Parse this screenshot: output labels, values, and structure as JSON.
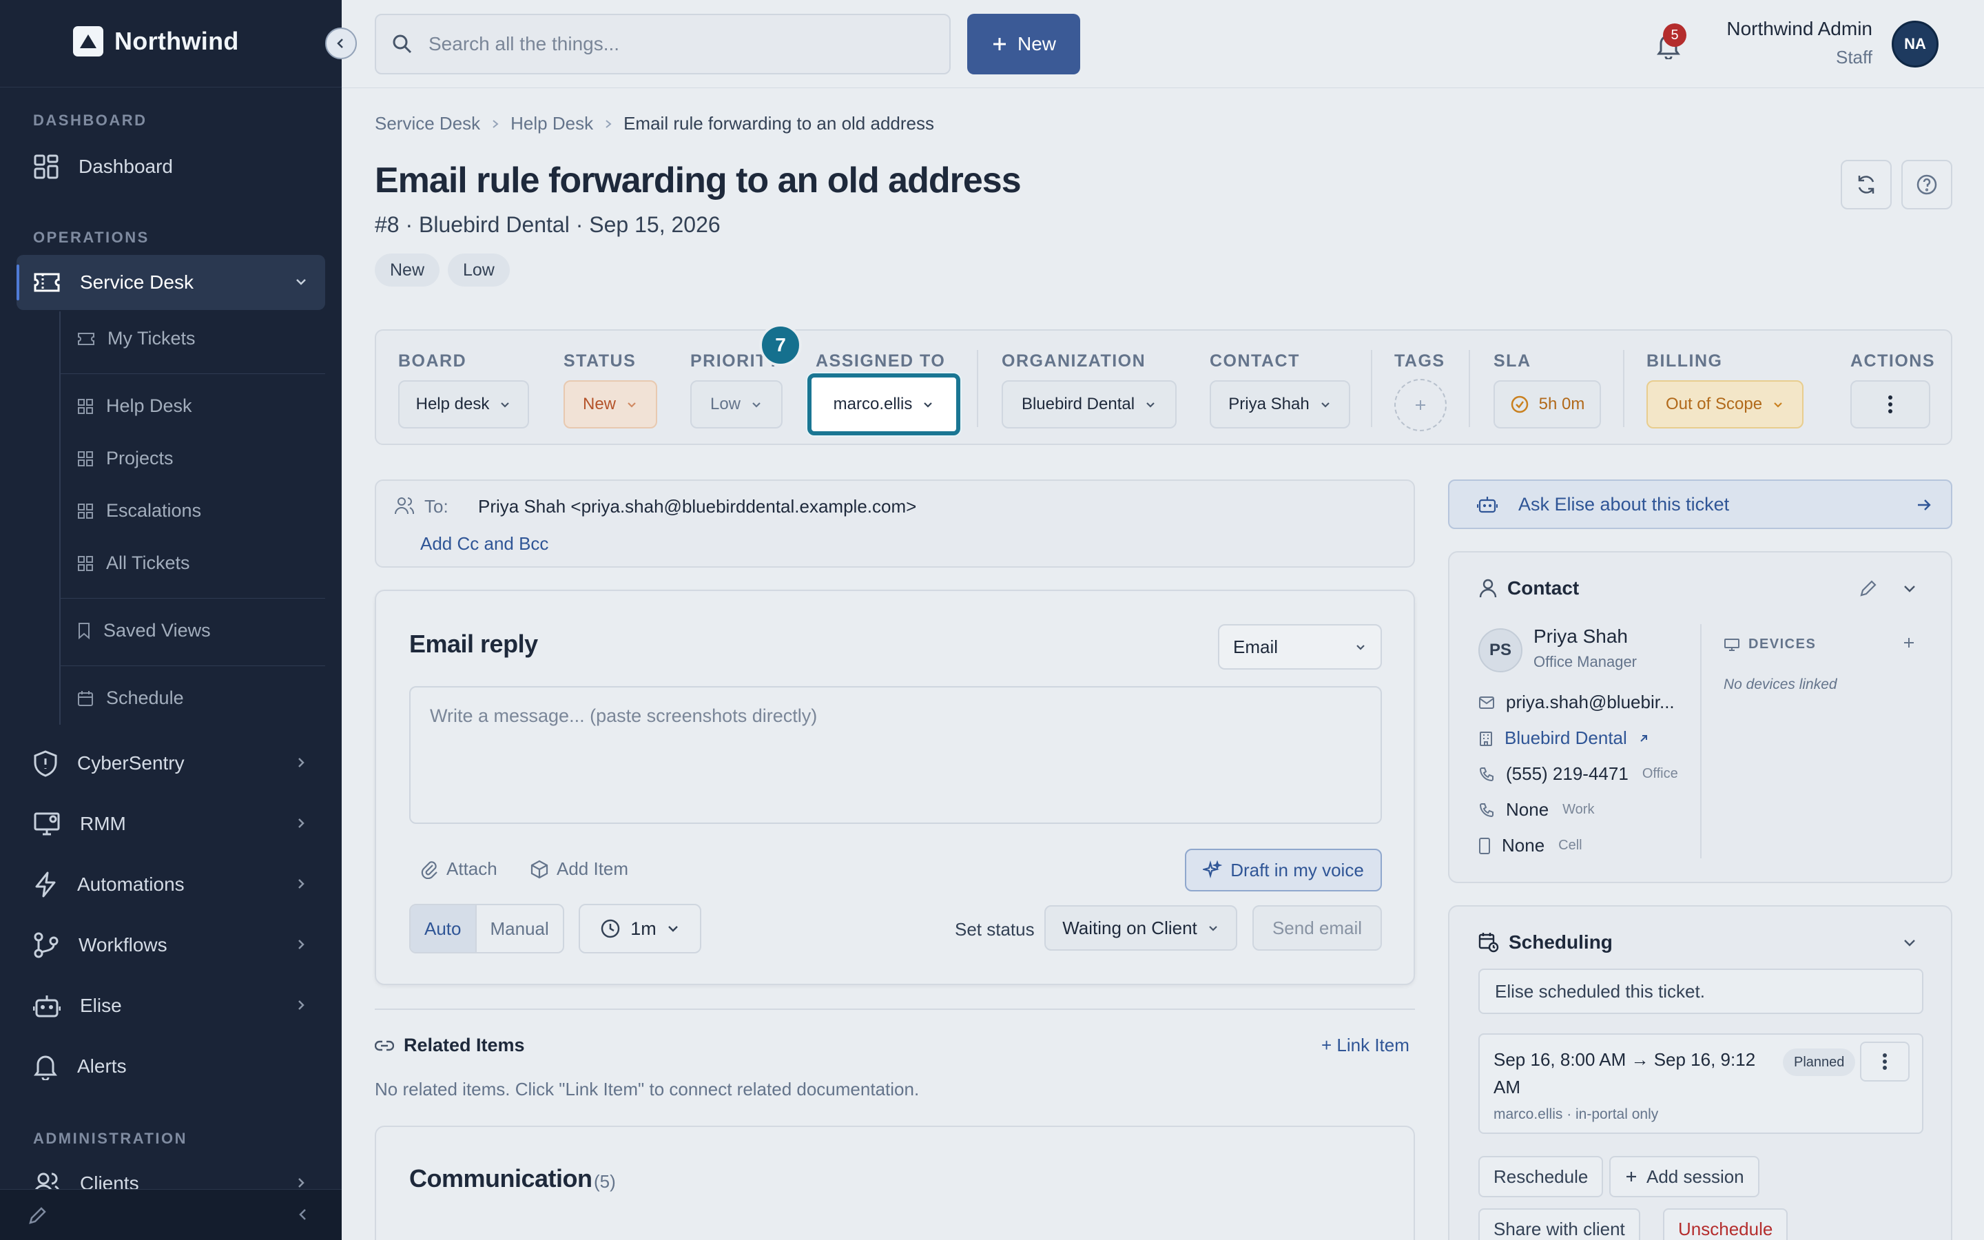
{
  "sidebar": {
    "brand": "Northwind",
    "sections": {
      "dashboard": "DASHBOARD",
      "operations": "OPERATIONS",
      "administration": "ADMINISTRATION"
    },
    "items": {
      "dashboard": "Dashboard",
      "service_desk": "Service Desk",
      "cybersentry": "CyberSentry",
      "rmm": "RMM",
      "automations": "Automations",
      "workflows": "Workflows",
      "elise": "Elise",
      "alerts": "Alerts",
      "clients": "Clients"
    },
    "sub_items": {
      "my_tickets": "My Tickets",
      "help_desk": "Help Desk",
      "projects": "Projects",
      "escalations": "Escalations",
      "all_tickets": "All Tickets",
      "saved_views": "Saved Views",
      "schedule": "Schedule"
    }
  },
  "topbar": {
    "search_placeholder": "Search all the things...",
    "new_label": "New",
    "notification_count": "5",
    "user_name": "Northwind Admin",
    "user_role": "Staff",
    "user_initials": "NA"
  },
  "breadcrumb": [
    "Service Desk",
    "Help Desk",
    "Email rule forwarding to an old address"
  ],
  "ticket": {
    "title": "Email rule forwarding to an old address",
    "subtitle": "#8 · Bluebird Dental · Sep 15, 2026",
    "badges": [
      "New",
      "Low"
    ]
  },
  "fields": {
    "board": {
      "label": "BOARD",
      "value": "Help desk"
    },
    "status": {
      "label": "STATUS",
      "value": "New"
    },
    "priority": {
      "label": "PRIORITY",
      "value": "Low"
    },
    "assigned_to": {
      "label": "ASSIGNED TO",
      "value": "marco.ellis"
    },
    "organization": {
      "label": "ORGANIZATION",
      "value": "Bluebird Dental"
    },
    "contact": {
      "label": "CONTACT",
      "value": "Priya Shah"
    },
    "tags": {
      "label": "TAGS"
    },
    "sla": {
      "label": "SLA",
      "value": "5h 0m"
    },
    "billing": {
      "label": "BILLING",
      "value": "Out of Scope"
    },
    "actions": {
      "label": "ACTIONS"
    }
  },
  "step_marker": "7",
  "recipients": {
    "to_label": "To:",
    "to_value": "Priya Shah <priya.shah@bluebirddental.example.com>",
    "add_cc": "Add Cc and Bcc"
  },
  "reply": {
    "title": "Email reply",
    "channel": "Email",
    "placeholder": "Write a message... (paste screenshots directly)",
    "attach": "Attach",
    "add_item": "Add Item",
    "draft": "Draft in my voice",
    "mode_auto": "Auto",
    "mode_manual": "Manual",
    "timer": "1m",
    "set_status_label": "Set status",
    "status_value": "Waiting on Client",
    "send": "Send email"
  },
  "related": {
    "title": "Related Items",
    "link_item": "+ Link Item",
    "empty": "No related items. Click \"Link Item\" to connect related documentation."
  },
  "communication": {
    "title": "Communication",
    "count": "(5)"
  },
  "right": {
    "ask_elise": "Ask Elise about this ticket",
    "contact": {
      "title": "Contact",
      "initials": "PS",
      "name": "Priya Shah",
      "role": "Office Manager",
      "email": "priya.shah@bluebir...",
      "org": "Bluebird Dental",
      "phone_office": "(555) 219-4471",
      "phone_office_tag": "Office",
      "phone_work": "None",
      "phone_work_tag": "Work",
      "phone_cell": "None",
      "phone_cell_tag": "Cell",
      "devices_label": "DEVICES",
      "devices_empty": "No devices linked"
    },
    "scheduling": {
      "title": "Scheduling",
      "note": "Elise scheduled this ticket.",
      "session_time": "Sep 16, 8:00 AM → Sep 16, 9:12 AM",
      "session_meta": "marco.ellis · in-portal only",
      "session_status": "Planned",
      "reschedule": "Reschedule",
      "add_session": "Add session",
      "share": "Share with client",
      "unschedule": "Unschedule"
    }
  }
}
